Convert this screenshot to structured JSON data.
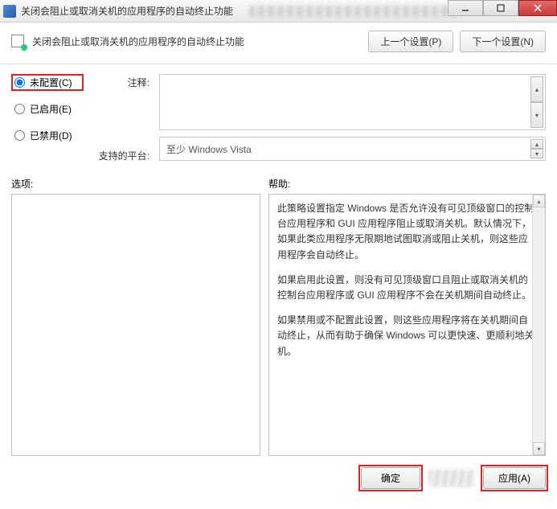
{
  "titlebar": {
    "text": "关闭会阻止或取消关机的应用程序的自动终止功能"
  },
  "header": {
    "title": "关闭会阻止或取消关机的应用程序的自动终止功能",
    "prev_setting": "上一个设置(P)",
    "next_setting": "下一个设置(N)"
  },
  "radios": {
    "not_configured": "未配置(C)",
    "enabled": "已启用(E)",
    "disabled": "已禁用(D)"
  },
  "labels": {
    "comment": "注释:",
    "supported": "支持的平台:",
    "options": "选项:",
    "help": "帮助:"
  },
  "fields": {
    "comment_value": "",
    "supported_value": "至少 Windows Vista"
  },
  "help": {
    "p1": "此策略设置指定 Windows 是否允许没有可见顶级窗口的控制台应用程序和 GUI 应用程序阻止或取消关机。默认情况下，如果此类应用程序无限期地试图取消或阻止关机，则这些应用程序会自动终止。",
    "p2": "如果启用此设置，则没有可见顶级窗口且阻止或取消关机的控制台应用程序或 GUI 应用程序不会在关机期间自动终止。",
    "p3": "如果禁用或不配置此设置，则这些应用程序将在关机期间自动终止，从而有助于确保 Windows 可以更快速、更顺利地关机。"
  },
  "footer": {
    "ok": "确定",
    "apply": "应用(A)"
  }
}
